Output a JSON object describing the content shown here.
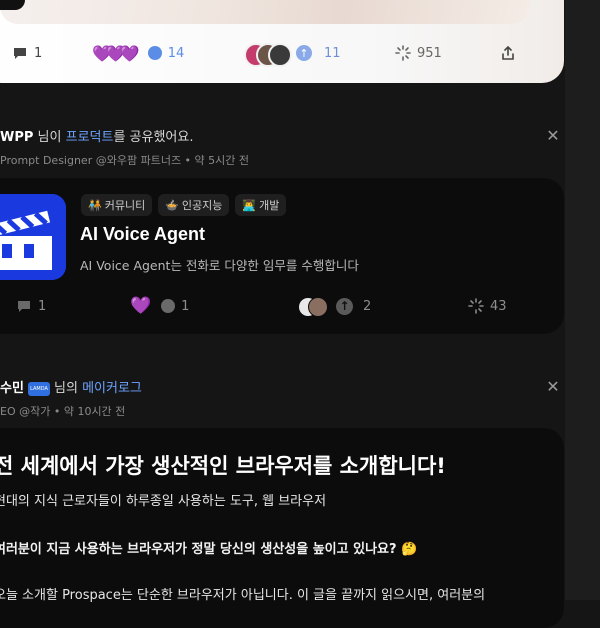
{
  "top_post": {
    "comment_count": "1",
    "reaction_hearts": "💜💜💜",
    "reaction_count": "14",
    "upvote_count": "11",
    "view_count": "951",
    "share_icon": "share-icon"
  },
  "activity1": {
    "user": "WPP",
    "middle": "님이",
    "link": "프로덕트",
    "suffix": "를 공유했어요.",
    "meta": "Prompt Designer @와우팜 파트너즈 •  약 5시간 전"
  },
  "project": {
    "tags": [
      {
        "icon": "🧑‍🤝‍🧑",
        "label": "커뮤니티"
      },
      {
        "icon": "🍲",
        "label": "인공지능"
      },
      {
        "icon": "👨‍💻",
        "label": "개발"
      }
    ],
    "title": "AI Voice Agent",
    "description": "AI Voice Agent는 전화로 다양한 임무를 수행합니다",
    "comment_count": "1",
    "reaction_heart": "💜",
    "reaction_count": "1",
    "upvote_count": "2",
    "view_count": "43",
    "brand_color": "#1a3ae0"
  },
  "activity2": {
    "user": "수민",
    "badge": "LAMDA",
    "middle": "님의",
    "link": "메이커로그",
    "meta": "EO @작가 •  약 10시간 전"
  },
  "post": {
    "title": "전 세계에서 가장 생산적인 브라우저를 소개합니다!",
    "subtitle": "현대의 지식 근로자들이 하루종일 사용하는 도구, 웹 브라우저",
    "question": "여러분이 지금 사용하는 브라우저가 정말 당신의 생산성을 높이고 있나요? 🤔",
    "body": "오늘 소개할 Prospace는 단순한 브라우저가 아닙니다. 이 글을 끝까지 읽으시면, 여러분의"
  }
}
